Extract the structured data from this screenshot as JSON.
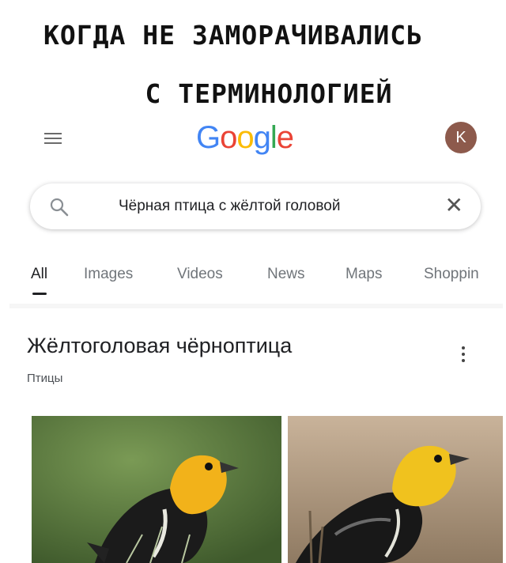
{
  "caption": {
    "line1": "КОГДА НЕ ЗАМОРАЧИВАЛИСЬ",
    "line2": "С ТЕРМИНОЛОГИЕЙ"
  },
  "header": {
    "logo_letters": [
      "G",
      "o",
      "o",
      "g",
      "l",
      "e"
    ],
    "logo_colors": [
      "#4285F4",
      "#EA4335",
      "#FBBC05",
      "#4285F4",
      "#34A853",
      "#EA4335"
    ],
    "avatar_letter": "K",
    "avatar_color": "#8d5a4c"
  },
  "search": {
    "query": "Чёрная птица с жёлтой головой",
    "clear_symbol": "✕"
  },
  "tabs": [
    {
      "label": "All",
      "active": true
    },
    {
      "label": "Images",
      "active": false
    },
    {
      "label": "Videos",
      "active": false
    },
    {
      "label": "News",
      "active": false
    },
    {
      "label": "Maps",
      "active": false
    },
    {
      "label": "Shoppin",
      "active": false
    }
  ],
  "knowledge_panel": {
    "title": "Жёлтоголовая чёрноптица",
    "subtitle": "Птицы"
  },
  "images": [
    {
      "subject": "yellow-headed-blackbird-photo",
      "background": "green"
    },
    {
      "subject": "yellow-headed-blackbird-photo",
      "background": "tan"
    }
  ]
}
